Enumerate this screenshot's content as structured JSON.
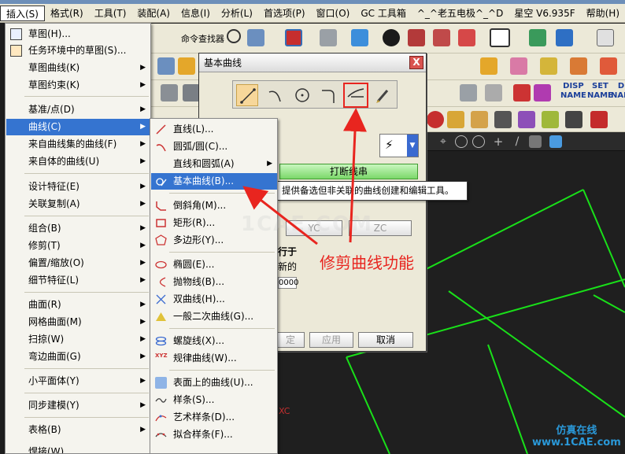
{
  "menubar": {
    "items": [
      "插入(S)",
      "格式(R)",
      "工具(T)",
      "装配(A)",
      "信息(I)",
      "分析(L)",
      "首选项(P)",
      "窗口(O)",
      "GC 工具箱",
      "^_^老五电极^_^D",
      "星空 V6.935F",
      "帮助(H)"
    ],
    "active": "插入(S)"
  },
  "toolbar": {
    "command_finder": "命令查找器",
    "disp_name_1": "DISP",
    "disp_name_2": "NAME",
    "set_name_1": "SET",
    "set_name_2": "NAME",
    "de_name_1": "DE",
    "de_name_2": "NAME"
  },
  "insert_menu": {
    "items": [
      {
        "label": "草图(H)...",
        "arrow": false,
        "icon": "sketch-icon"
      },
      {
        "label": "任务环境中的草图(S)...",
        "arrow": false,
        "icon": "task-sketch-icon"
      },
      {
        "label": "草图曲线(K)",
        "arrow": true,
        "icon": ""
      },
      {
        "label": "草图约束(K)",
        "arrow": true,
        "icon": ""
      },
      {
        "label": "基准/点(D)",
        "arrow": true,
        "icon": ""
      },
      {
        "label": "曲线(C)",
        "arrow": true,
        "icon": ""
      },
      {
        "label": "来自曲线集的曲线(F)",
        "arrow": true,
        "icon": ""
      },
      {
        "label": "来自体的曲线(U)",
        "arrow": true,
        "icon": ""
      },
      {
        "label": "设计特征(E)",
        "arrow": true,
        "icon": ""
      },
      {
        "label": "关联复制(A)",
        "arrow": true,
        "icon": ""
      },
      {
        "label": "组合(B)",
        "arrow": true,
        "icon": ""
      },
      {
        "label": "修剪(T)",
        "arrow": true,
        "icon": ""
      },
      {
        "label": "偏置/缩放(O)",
        "arrow": true,
        "icon": ""
      },
      {
        "label": "细节特征(L)",
        "arrow": true,
        "icon": ""
      },
      {
        "label": "曲面(R)",
        "arrow": true,
        "icon": ""
      },
      {
        "label": "网格曲面(M)",
        "arrow": true,
        "icon": ""
      },
      {
        "label": "扫掠(W)",
        "arrow": true,
        "icon": ""
      },
      {
        "label": "弯边曲面(G)",
        "arrow": true,
        "icon": ""
      },
      {
        "label": "小平面体(Y)",
        "arrow": true,
        "icon": ""
      },
      {
        "label": "同步建模(Y)",
        "arrow": true,
        "icon": ""
      },
      {
        "label": "表格(B)",
        "arrow": true,
        "icon": ""
      },
      {
        "label": "焊接(W)",
        "arrow": true,
        "icon": ""
      }
    ],
    "highlighted": "曲线(C)"
  },
  "curve_submenu": {
    "items": [
      {
        "label": "直线(L)...",
        "arrow": false,
        "icon": "line-icon"
      },
      {
        "label": "圆弧/圆(C)...",
        "arrow": false,
        "icon": "arc-icon"
      },
      {
        "label": "直线和圆弧(A)",
        "arrow": true,
        "icon": ""
      },
      {
        "label": "基本曲线(B)...",
        "arrow": false,
        "icon": "basic-curve-icon"
      },
      {
        "label": "倒斜角(M)...",
        "arrow": false,
        "icon": "chamfer-icon"
      },
      {
        "label": "矩形(R)...",
        "arrow": false,
        "icon": "rectangle-icon"
      },
      {
        "label": "多边形(Y)...",
        "arrow": false,
        "icon": "polygon-icon"
      },
      {
        "label": "椭圆(E)...",
        "arrow": false,
        "icon": "ellipse-icon"
      },
      {
        "label": "抛物线(B)...",
        "arrow": false,
        "icon": "parabola-icon"
      },
      {
        "label": "双曲线(H)...",
        "arrow": false,
        "icon": "hyperbola-icon"
      },
      {
        "label": "一般二次曲线(G)...",
        "arrow": false,
        "icon": "conic-icon"
      },
      {
        "label": "螺旋线(X)...",
        "arrow": false,
        "icon": "helix-icon"
      },
      {
        "label": "规律曲线(W)...",
        "arrow": false,
        "icon": "law-curve-icon"
      },
      {
        "label": "表面上的曲线(U)...",
        "arrow": false,
        "icon": "curve-on-surface-icon"
      },
      {
        "label": "样条(S)...",
        "arrow": false,
        "icon": "spline-icon"
      },
      {
        "label": "艺术样条(D)...",
        "arrow": false,
        "icon": "studio-spline-icon"
      },
      {
        "label": "拟合样条(F)...",
        "arrow": false,
        "icon": "fit-spline-icon"
      }
    ],
    "highlighted": "基本曲线(B)..."
  },
  "dialog": {
    "title": "基本曲线",
    "close": "X",
    "trim_button": "打断线串",
    "yc_button": "YC",
    "zc_button": "ZC",
    "parallel_label": "行于",
    "new_label": "新的",
    "value": "0000",
    "ok": "定",
    "apply": "应用",
    "cancel": "取消"
  },
  "tooltip": {
    "text": "提供备选但非关联的曲线创建和编辑工具。"
  },
  "annotation": {
    "text": "修剪曲线功能",
    "color": "#e8251f"
  },
  "watermark": {
    "big": "1CAE.COM",
    "br_line1": "仿真在线",
    "br_line2": "www.1CAE.com"
  },
  "viewport": {
    "xc_label": "XC",
    "line_color": "#19e019"
  }
}
